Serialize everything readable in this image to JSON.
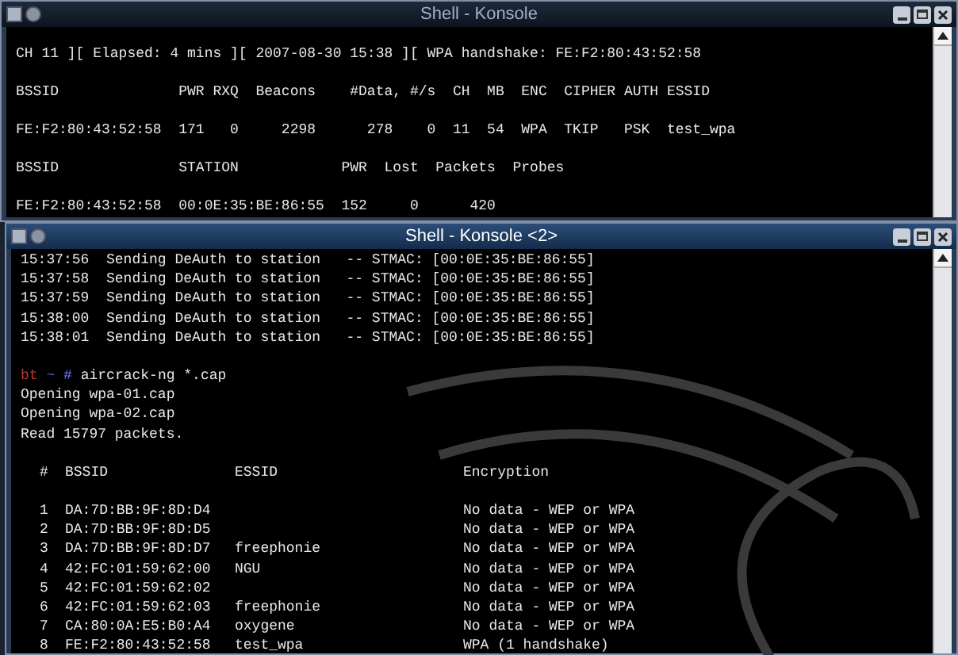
{
  "windows": [
    {
      "title": "Shell - Konsole",
      "active": false,
      "lines": [
        "CH 11 ][ Elapsed: 4 mins ][ 2007-08-30 15:38 ][ WPA handshake: FE:F2:80:43:52:58",
        "BSSID              PWR RXQ  Beacons    #Data, #/s  CH  MB  ENC  CIPHER AUTH ESSID",
        "FE:F2:80:43:52:58  171   0     2298      278    0  11  54  WPA  TKIP   PSK  test_wpa",
        "BSSID              STATION            PWR  Lost  Packets  Probes",
        "FE:F2:80:43:52:58  00:0E:35:BE:86:55  152     0      420"
      ]
    },
    {
      "title": "Shell - Konsole <2>",
      "active": true,
      "lines": [
        "15:37:56  Sending DeAuth to station   -- STMAC: [00:0E:35:BE:86:55]",
        "15:37:58  Sending DeAuth to station   -- STMAC: [00:0E:35:BE:86:55]",
        "15:37:59  Sending DeAuth to station   -- STMAC: [00:0E:35:BE:86:55]",
        "15:38:00  Sending DeAuth to station   -- STMAC: [00:0E:35:BE:86:55]",
        "15:38:01  Sending DeAuth to station   -- STMAC: [00:0E:35:BE:86:55]"
      ],
      "prompt": {
        "user": "bt",
        "dir": "~",
        "symbol": "#",
        "command": "aircrack-ng *.cap"
      },
      "output": [
        "Opening wpa-01.cap",
        "Opening wpa-02.cap",
        "Read 15797 packets."
      ],
      "table": {
        "columns": [
          "#",
          "BSSID",
          "ESSID",
          "Encryption"
        ],
        "rows": [
          {
            "index": "1",
            "bssid": "DA:7D:BB:9F:8D:D4",
            "encryption": "No data - WEP or WPA"
          },
          {
            "index": "2",
            "bssid": "DA:7D:BB:9F:8D:D5",
            "encryption": "No data - WEP or WPA"
          },
          {
            "index": "3",
            "bssid": "DA:7D:BB:9F:8D:D7",
            "essid": "freephonie",
            "encryption": "No data - WEP or WPA"
          },
          {
            "index": "4",
            "bssid": "42:FC:01:59:62:00",
            "essid": "NGU",
            "encryption": "No data - WEP or WPA"
          },
          {
            "index": "5",
            "bssid": "42:FC:01:59:62:02",
            "encryption": "No data - WEP or WPA"
          },
          {
            "index": "6",
            "bssid": "42:FC:01:59:62:03",
            "essid": "freephonie",
            "encryption": "No data - WEP or WPA"
          },
          {
            "index": "7",
            "bssid": "CA:80:0A:E5:B0:A4",
            "essid": "oxygene",
            "encryption": "No data - WEP or WPA"
          },
          {
            "index": "8",
            "bssid": "FE:F2:80:43:52:58",
            "essid": "test_wpa",
            "encryption": "WPA (1 handshake)"
          }
        ]
      }
    }
  ]
}
